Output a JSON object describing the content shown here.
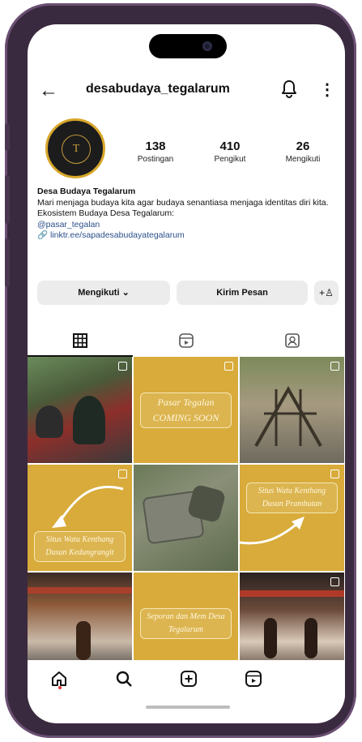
{
  "profile": {
    "username": "desabudaya_tegalarum",
    "avatar_letter": "T",
    "stats": [
      {
        "value": "138",
        "label": "Postingan"
      },
      {
        "value": "410",
        "label": "Pengikut"
      },
      {
        "value": "26",
        "label": "Mengikuti"
      }
    ],
    "name": "Desa Budaya Tegalarum",
    "bio_line1": "Mari menjaga budaya kita agar budaya senantiasa menjaga identitas diri kita.",
    "bio_line2": "Ekosistem Budaya Desa Tegalarum:",
    "mention": "@pasar_tegalan",
    "link": "linktr.ee/sapadesabudayategalarum"
  },
  "actions": {
    "follow_label": "Mengikuti ⌄",
    "message_label": "Kirim Pesan"
  },
  "posts": {
    "pasar_tegalan": "Pasar Tegalan COMING SOON",
    "watu_kenthang_kedungrangit": "Situs Watu Kenthang Dusun Kedungrangit",
    "watu_kenthang_prambutan": "Situs Watu Kenthang Dusun Prambutan",
    "seporan_mem": "Seporan dan Mem Desa Tegalarum"
  },
  "colors": {
    "accent": "#d8ab3a",
    "link": "#2a4f8a",
    "frame": "#3a2a3f"
  },
  "icons": {
    "back": "arrow-left-icon",
    "bell": "bell-icon",
    "more": "more-vertical-icon",
    "grid": "grid-icon",
    "reels": "reels-icon",
    "tagged": "tagged-icon",
    "home": "home-icon",
    "search": "search-icon",
    "create": "plus-square-icon"
  }
}
